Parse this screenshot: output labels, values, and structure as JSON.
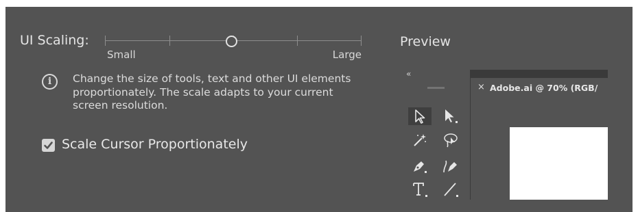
{
  "ui_scaling": {
    "label": "UI Scaling:",
    "min_label": "Small",
    "max_label": "Large",
    "value_fraction": 0.48
  },
  "info": {
    "icon": "info-icon",
    "text": "Change the size of tools, text and other UI elements proportionately. The scale adapts to your current screen resolution."
  },
  "scale_cursor": {
    "label": "Scale Cursor Proportionately",
    "checked": true
  },
  "preview": {
    "label": "Preview",
    "collapse_glyph": "«",
    "tab": {
      "close_glyph": "×",
      "title": "Adobe.ai @ 70% (RGB/"
    },
    "tools": [
      "selection-tool-icon",
      "direct-selection-tool-icon",
      "magic-wand-tool-icon",
      "lasso-tool-icon",
      "pen-tool-icon",
      "curvature-tool-icon",
      "type-tool-icon",
      "line-segment-tool-icon"
    ]
  },
  "colors": {
    "panel_bg": "#535353",
    "text": "#e4e4e4",
    "dark": "#2b2b2b"
  }
}
